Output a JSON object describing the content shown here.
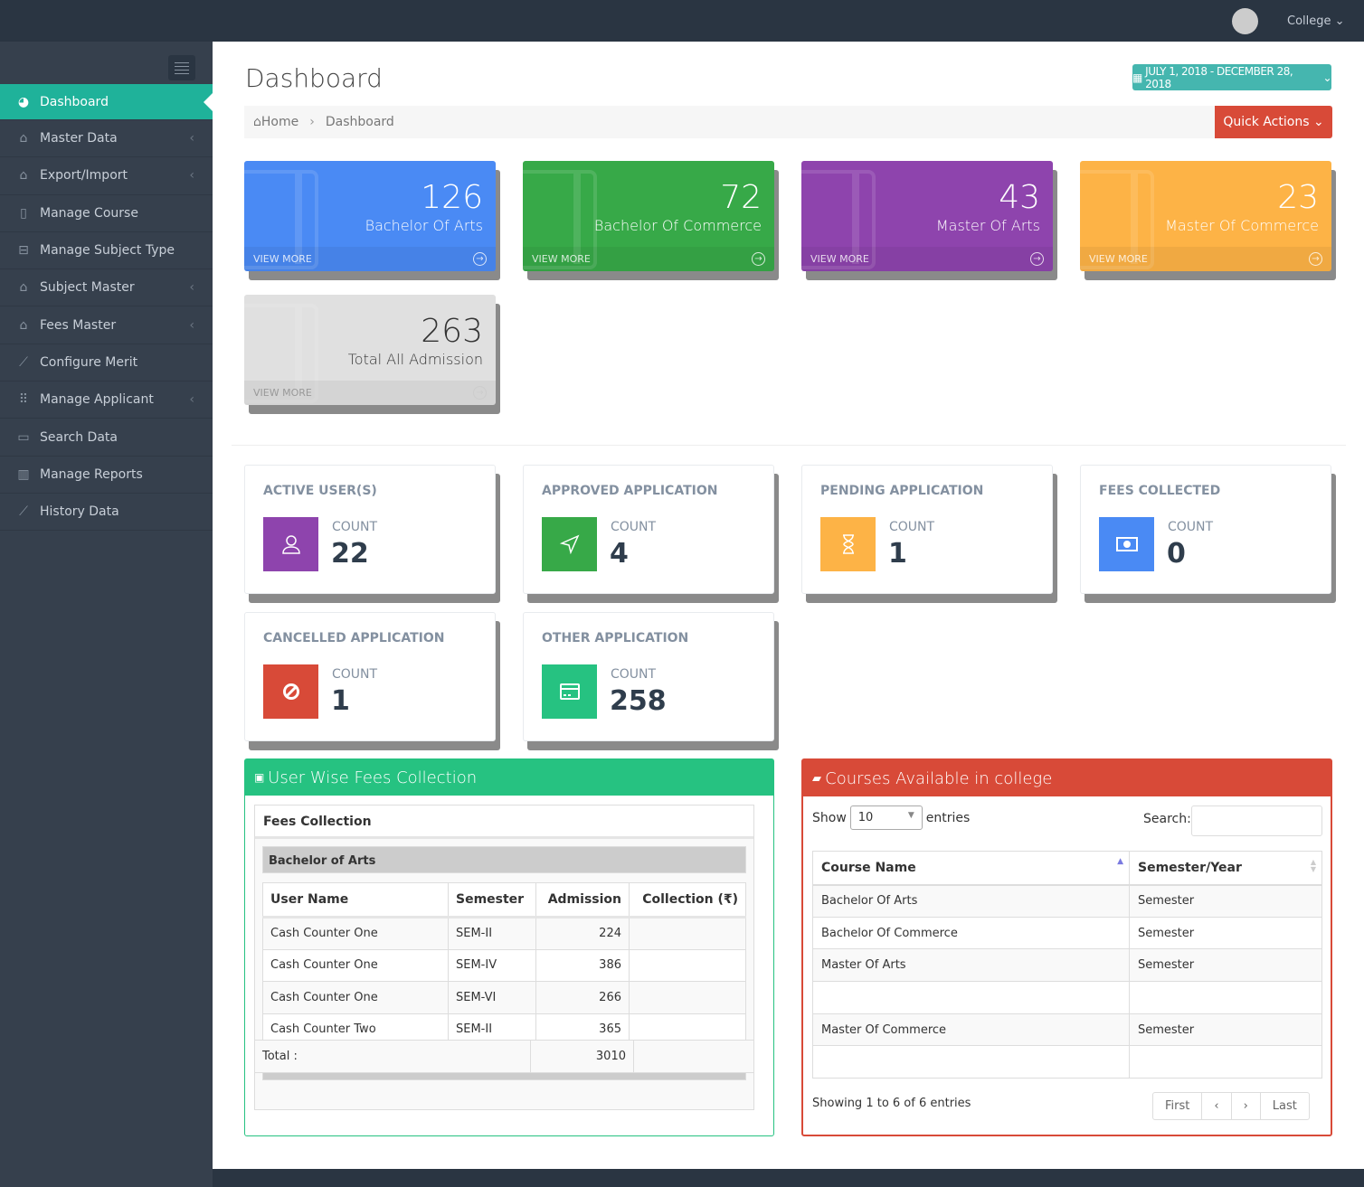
{
  "topbar": {
    "user_menu": "College"
  },
  "sidebar": {
    "items": [
      {
        "label": "Dashboard",
        "icon": "dashboard-icon",
        "active": true
      },
      {
        "label": "Master Data",
        "icon": "home-icon",
        "submenu": true
      },
      {
        "label": "Export/Import",
        "icon": "home-icon",
        "submenu": true
      },
      {
        "label": "Manage Course",
        "icon": "book-icon"
      },
      {
        "label": "Manage Subject Type",
        "icon": "briefcase-icon"
      },
      {
        "label": "Subject Master",
        "icon": "home-icon",
        "submenu": true
      },
      {
        "label": "Fees Master",
        "icon": "home-icon",
        "submenu": true
      },
      {
        "label": "Configure Merit",
        "icon": "chart-line-icon"
      },
      {
        "label": "Manage Applicant",
        "icon": "grid-icon",
        "submenu": true
      },
      {
        "label": "Search Data",
        "icon": "keyboard-icon"
      },
      {
        "label": "Manage Reports",
        "icon": "bar-chart-icon"
      },
      {
        "label": "History Data",
        "icon": "chart-line-icon"
      }
    ]
  },
  "header": {
    "title": "Dashboard",
    "date_range": "JULY 1, 2018 - DECEMBER 28, 2018",
    "quick_actions": "Quick Actions",
    "breadcrumb": [
      "Home",
      "Dashboard"
    ]
  },
  "tiles": [
    {
      "count": "126",
      "label": "Bachelor Of Arts",
      "link": "VIEW MORE",
      "color": "#4a8af4"
    },
    {
      "count": "72",
      "label": "Bachelor Of Commerce",
      "link": "VIEW MORE",
      "color": "#37a948"
    },
    {
      "count": "43",
      "label": "Master Of Arts",
      "link": "VIEW MORE",
      "color": "#8e44ad"
    },
    {
      "count": "23",
      "label": "Master Of Commerce",
      "link": "VIEW MORE",
      "color": "#fdb346"
    },
    {
      "count": "263",
      "label": "Total All Admission",
      "link": "VIEW MORE",
      "color": "#e0e0e0"
    }
  ],
  "stats": [
    {
      "title": "ACTIVE USER(S)",
      "count_label": "COUNT",
      "count": "22",
      "color": "#8e44ad",
      "icon": "user-icon"
    },
    {
      "title": "APPROVED APPLICATION",
      "count_label": "COUNT",
      "count": "4",
      "color": "#37a948",
      "icon": "send-icon"
    },
    {
      "title": "PENDING APPLICATION",
      "count_label": "COUNT",
      "count": "1",
      "color": "#fdb346",
      "icon": "hourglass-icon"
    },
    {
      "title": "FEES COLLECTED",
      "count_label": "COUNT",
      "count": "0",
      "color": "#4a8af4",
      "icon": "money-icon"
    },
    {
      "title": "CANCELLED APPLICATION",
      "count_label": "COUNT",
      "count": "1",
      "color": "#d84a38",
      "icon": "ban-icon"
    },
    {
      "title": "OTHER APPLICATION",
      "count_label": "COUNT",
      "count": "258",
      "color": "#26c281",
      "icon": "credit-card-icon"
    }
  ],
  "fees": {
    "title": "User Wise Fees Collection",
    "box_title": "Fees Collection",
    "group": "Bachelor of Arts",
    "columns": [
      "User Name",
      "Semester",
      "Admission",
      "Collection (₹)"
    ],
    "rows": [
      [
        "Cash Counter One",
        "SEM-II",
        "224",
        ""
      ],
      [
        "Cash Counter One",
        "SEM-IV",
        "386",
        ""
      ],
      [
        "Cash Counter One",
        "SEM-VI",
        "266",
        ""
      ],
      [
        "Cash Counter Two",
        "SEM-II",
        "365",
        ""
      ]
    ],
    "total_label": "Total :",
    "total_admission": "3010"
  },
  "courses": {
    "title": "Courses Available in college",
    "show_label": "Show",
    "page_size": "10",
    "entries_label": "entries",
    "search_label": "Search:",
    "columns": [
      "Course Name",
      "Semester/Year"
    ],
    "rows": [
      [
        "Bachelor Of Arts",
        "Semester"
      ],
      [
        "Bachelor Of Commerce",
        "Semester"
      ],
      [
        "Master Of Arts",
        "Semester"
      ],
      [
        "",
        ""
      ],
      [
        "Master Of Commerce",
        "Semester"
      ],
      [
        "",
        ""
      ]
    ],
    "info": "Showing 1 to 6 of 6 entries",
    "pager": [
      "First",
      "‹",
      "›",
      "Last"
    ]
  }
}
